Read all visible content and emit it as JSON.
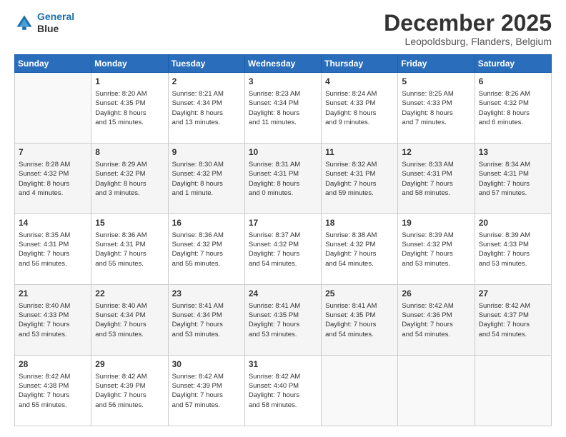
{
  "header": {
    "logo_line1": "General",
    "logo_line2": "Blue",
    "month": "December 2025",
    "location": "Leopoldsburg, Flanders, Belgium"
  },
  "days_of_week": [
    "Sunday",
    "Monday",
    "Tuesday",
    "Wednesday",
    "Thursday",
    "Friday",
    "Saturday"
  ],
  "weeks": [
    [
      {
        "day": "",
        "info": ""
      },
      {
        "day": "1",
        "info": "Sunrise: 8:20 AM\nSunset: 4:35 PM\nDaylight: 8 hours\nand 15 minutes."
      },
      {
        "day": "2",
        "info": "Sunrise: 8:21 AM\nSunset: 4:34 PM\nDaylight: 8 hours\nand 13 minutes."
      },
      {
        "day": "3",
        "info": "Sunrise: 8:23 AM\nSunset: 4:34 PM\nDaylight: 8 hours\nand 11 minutes."
      },
      {
        "day": "4",
        "info": "Sunrise: 8:24 AM\nSunset: 4:33 PM\nDaylight: 8 hours\nand 9 minutes."
      },
      {
        "day": "5",
        "info": "Sunrise: 8:25 AM\nSunset: 4:33 PM\nDaylight: 8 hours\nand 7 minutes."
      },
      {
        "day": "6",
        "info": "Sunrise: 8:26 AM\nSunset: 4:32 PM\nDaylight: 8 hours\nand 6 minutes."
      }
    ],
    [
      {
        "day": "7",
        "info": "Sunrise: 8:28 AM\nSunset: 4:32 PM\nDaylight: 8 hours\nand 4 minutes."
      },
      {
        "day": "8",
        "info": "Sunrise: 8:29 AM\nSunset: 4:32 PM\nDaylight: 8 hours\nand 3 minutes."
      },
      {
        "day": "9",
        "info": "Sunrise: 8:30 AM\nSunset: 4:32 PM\nDaylight: 8 hours\nand 1 minute."
      },
      {
        "day": "10",
        "info": "Sunrise: 8:31 AM\nSunset: 4:31 PM\nDaylight: 8 hours\nand 0 minutes."
      },
      {
        "day": "11",
        "info": "Sunrise: 8:32 AM\nSunset: 4:31 PM\nDaylight: 7 hours\nand 59 minutes."
      },
      {
        "day": "12",
        "info": "Sunrise: 8:33 AM\nSunset: 4:31 PM\nDaylight: 7 hours\nand 58 minutes."
      },
      {
        "day": "13",
        "info": "Sunrise: 8:34 AM\nSunset: 4:31 PM\nDaylight: 7 hours\nand 57 minutes."
      }
    ],
    [
      {
        "day": "14",
        "info": "Sunrise: 8:35 AM\nSunset: 4:31 PM\nDaylight: 7 hours\nand 56 minutes."
      },
      {
        "day": "15",
        "info": "Sunrise: 8:36 AM\nSunset: 4:31 PM\nDaylight: 7 hours\nand 55 minutes."
      },
      {
        "day": "16",
        "info": "Sunrise: 8:36 AM\nSunset: 4:32 PM\nDaylight: 7 hours\nand 55 minutes."
      },
      {
        "day": "17",
        "info": "Sunrise: 8:37 AM\nSunset: 4:32 PM\nDaylight: 7 hours\nand 54 minutes."
      },
      {
        "day": "18",
        "info": "Sunrise: 8:38 AM\nSunset: 4:32 PM\nDaylight: 7 hours\nand 54 minutes."
      },
      {
        "day": "19",
        "info": "Sunrise: 8:39 AM\nSunset: 4:32 PM\nDaylight: 7 hours\nand 53 minutes."
      },
      {
        "day": "20",
        "info": "Sunrise: 8:39 AM\nSunset: 4:33 PM\nDaylight: 7 hours\nand 53 minutes."
      }
    ],
    [
      {
        "day": "21",
        "info": "Sunrise: 8:40 AM\nSunset: 4:33 PM\nDaylight: 7 hours\nand 53 minutes."
      },
      {
        "day": "22",
        "info": "Sunrise: 8:40 AM\nSunset: 4:34 PM\nDaylight: 7 hours\nand 53 minutes."
      },
      {
        "day": "23",
        "info": "Sunrise: 8:41 AM\nSunset: 4:34 PM\nDaylight: 7 hours\nand 53 minutes."
      },
      {
        "day": "24",
        "info": "Sunrise: 8:41 AM\nSunset: 4:35 PM\nDaylight: 7 hours\nand 53 minutes."
      },
      {
        "day": "25",
        "info": "Sunrise: 8:41 AM\nSunset: 4:35 PM\nDaylight: 7 hours\nand 54 minutes."
      },
      {
        "day": "26",
        "info": "Sunrise: 8:42 AM\nSunset: 4:36 PM\nDaylight: 7 hours\nand 54 minutes."
      },
      {
        "day": "27",
        "info": "Sunrise: 8:42 AM\nSunset: 4:37 PM\nDaylight: 7 hours\nand 54 minutes."
      }
    ],
    [
      {
        "day": "28",
        "info": "Sunrise: 8:42 AM\nSunset: 4:38 PM\nDaylight: 7 hours\nand 55 minutes."
      },
      {
        "day": "29",
        "info": "Sunrise: 8:42 AM\nSunset: 4:39 PM\nDaylight: 7 hours\nand 56 minutes."
      },
      {
        "day": "30",
        "info": "Sunrise: 8:42 AM\nSunset: 4:39 PM\nDaylight: 7 hours\nand 57 minutes."
      },
      {
        "day": "31",
        "info": "Sunrise: 8:42 AM\nSunset: 4:40 PM\nDaylight: 7 hours\nand 58 minutes."
      },
      {
        "day": "",
        "info": ""
      },
      {
        "day": "",
        "info": ""
      },
      {
        "day": "",
        "info": ""
      }
    ]
  ]
}
